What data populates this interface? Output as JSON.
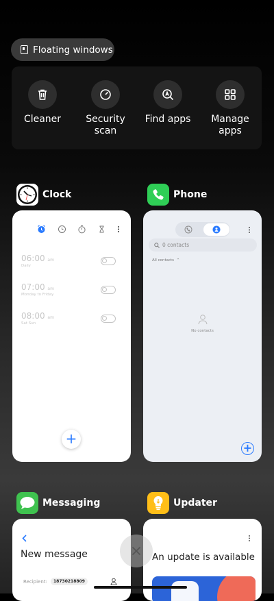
{
  "floating_windows": {
    "label": "Floating windows",
    "icon": "floating-window-icon"
  },
  "quick_actions": [
    {
      "label": "Cleaner",
      "icon": "trash-icon"
    },
    {
      "label": "Security\nscan",
      "line1": "Security",
      "line2": "scan",
      "icon": "security-scan-icon"
    },
    {
      "label": "Find apps",
      "line1": "Find apps",
      "line2": "",
      "icon": "find-apps-icon"
    },
    {
      "label": "Manage\napps",
      "line1": "Manage",
      "line2": "apps",
      "icon": "manage-apps-icon"
    }
  ],
  "apps": {
    "clock": {
      "name": "Clock",
      "alarms": [
        {
          "time": "06:00",
          "ampm": "am",
          "repeat": "Daily"
        },
        {
          "time": "07:00",
          "ampm": "am",
          "repeat": "Monday to Friday"
        },
        {
          "time": "08:00",
          "ampm": "am",
          "repeat": "Sat Sun"
        }
      ],
      "add": "+"
    },
    "phone": {
      "name": "Phone",
      "search_placeholder": "0 contacts",
      "filter": "All contacts",
      "empty": "No contacts",
      "add": "+"
    },
    "messaging": {
      "name": "Messaging",
      "title": "New message",
      "recipient_label": "Recipient:",
      "recipient_value": "18730218809"
    },
    "updater": {
      "name": "Updater",
      "title": "An update is available"
    }
  },
  "colors": {
    "accent": "#2a7bff",
    "phone_green": "#2fce56",
    "messaging_green": "#3fc24f",
    "updater_yellow": "#ffbe18"
  }
}
